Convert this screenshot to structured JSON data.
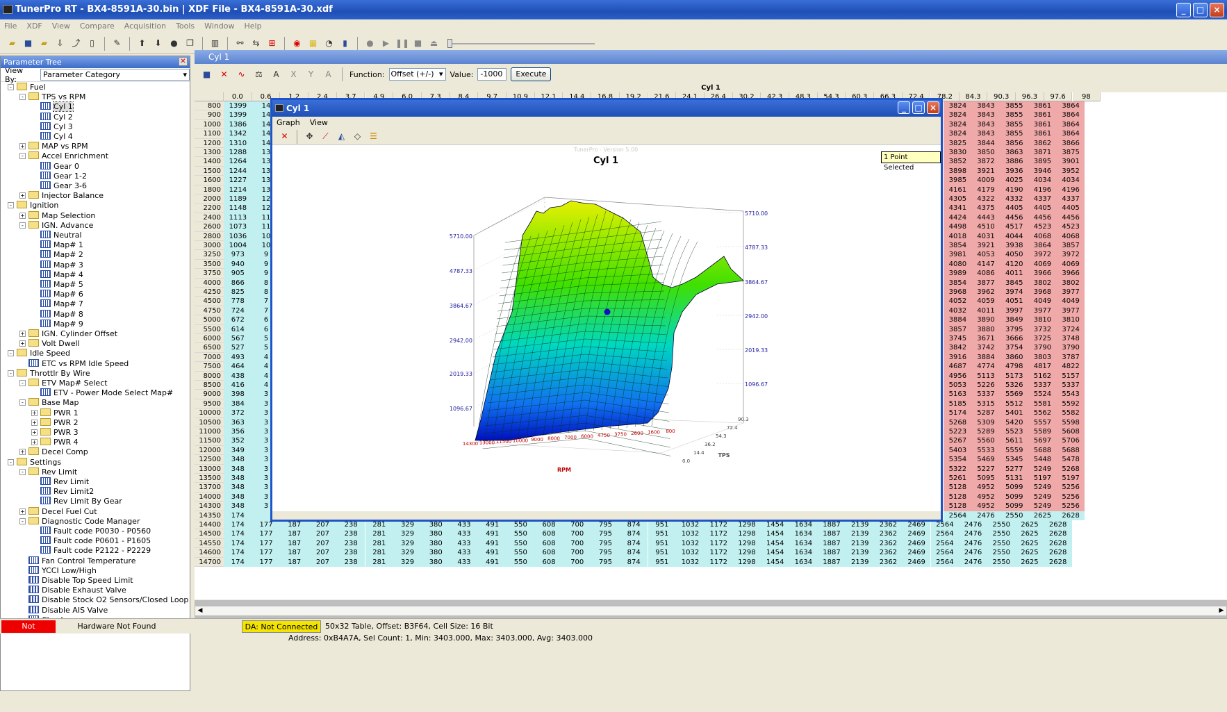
{
  "app": {
    "title": "TunerPro RT - BX4-8591A-30.bin | XDF File - BX4-8591A-30.xdf",
    "menu": [
      "File",
      "XDF",
      "View",
      "Compare",
      "Acquisition",
      "Tools",
      "Window",
      "Help"
    ]
  },
  "tree": {
    "title": "Parameter Tree",
    "view_by_label": "View By:",
    "view_by_value": "Parameter Category",
    "nodes": [
      [
        "Fuel",
        0,
        "fold",
        "-"
      ],
      [
        "TPS vs RPM",
        1,
        "fold",
        "-"
      ],
      [
        "Cyl 1",
        2,
        "grid",
        ""
      ],
      [
        "Cyl 2",
        2,
        "grid",
        ""
      ],
      [
        "Cyl 3",
        2,
        "grid",
        ""
      ],
      [
        "Cyl 4",
        2,
        "grid",
        ""
      ],
      [
        "MAP vs RPM",
        1,
        "fold",
        "+"
      ],
      [
        "Accel Enrichment",
        1,
        "fold",
        "-"
      ],
      [
        "Gear 0",
        2,
        "grid",
        ""
      ],
      [
        "Gear 1-2",
        2,
        "grid",
        ""
      ],
      [
        "Gear 3-6",
        2,
        "grid",
        ""
      ],
      [
        "Injector Balance",
        1,
        "fold",
        "+"
      ],
      [
        "Ignition",
        0,
        "fold",
        "-"
      ],
      [
        "Map Selection",
        1,
        "fold",
        "+"
      ],
      [
        "IGN. Advance",
        1,
        "fold",
        "-"
      ],
      [
        "Neutral",
        2,
        "grid",
        ""
      ],
      [
        "Map# 1",
        2,
        "grid",
        ""
      ],
      [
        "Map# 2",
        2,
        "grid",
        ""
      ],
      [
        "Map# 3",
        2,
        "grid",
        ""
      ],
      [
        "Map# 4",
        2,
        "grid",
        ""
      ],
      [
        "Map# 5",
        2,
        "grid",
        ""
      ],
      [
        "Map# 6",
        2,
        "grid",
        ""
      ],
      [
        "Map# 7",
        2,
        "grid",
        ""
      ],
      [
        "Map# 8",
        2,
        "grid",
        ""
      ],
      [
        "Map# 9",
        2,
        "grid",
        ""
      ],
      [
        "IGN. Cylinder Offset",
        1,
        "fold",
        "+"
      ],
      [
        "Volt Dwell",
        1,
        "fold",
        "+"
      ],
      [
        "Idle Speed",
        0,
        "fold",
        "-"
      ],
      [
        "ETC vs RPM Idle Speed",
        1,
        "grid",
        ""
      ],
      [
        "Throttlr By Wire",
        0,
        "fold",
        "-"
      ],
      [
        "ETV Map# Select",
        1,
        "fold",
        "-"
      ],
      [
        "ETV - Power Mode Select Map#",
        2,
        "grid",
        ""
      ],
      [
        "Base Map",
        1,
        "fold",
        "-"
      ],
      [
        "PWR 1",
        2,
        "fold",
        "+"
      ],
      [
        "PWR 2",
        2,
        "fold",
        "+"
      ],
      [
        "PWR 3",
        2,
        "fold",
        "+"
      ],
      [
        "PWR 4",
        2,
        "fold",
        "+"
      ],
      [
        "Decel Comp",
        1,
        "fold",
        "+"
      ],
      [
        "Settings",
        0,
        "fold",
        "-"
      ],
      [
        "Rev Limit",
        1,
        "fold",
        "-"
      ],
      [
        "Rev Limit",
        2,
        "grid",
        ""
      ],
      [
        "Rev Limit2",
        2,
        "grid",
        ""
      ],
      [
        "Rev Limit By Gear",
        2,
        "grid",
        ""
      ],
      [
        "Decel Fuel Cut",
        1,
        "fold",
        "+"
      ],
      [
        "Diagnostic Code Manager",
        1,
        "fold",
        "-"
      ],
      [
        "Fault code  P0030 - P0560",
        2,
        "grid",
        ""
      ],
      [
        "Fault code  P0601 - P1605",
        2,
        "grid",
        ""
      ],
      [
        "Fault code  P2122 - P2229",
        2,
        "grid",
        ""
      ],
      [
        "Fan Control Temperature",
        1,
        "grid",
        ""
      ],
      [
        "YCCI Low/High",
        1,
        "grid",
        ""
      ],
      [
        "Disable Top Speed Limit",
        1,
        "bits",
        ""
      ],
      [
        "Disable Exhaust Valve",
        1,
        "bits",
        ""
      ],
      [
        "Disable Stock O2 Sensors/Closed Loop",
        1,
        "bits",
        ""
      ],
      [
        "Disable AIS Valve",
        1,
        "bits",
        ""
      ],
      [
        "Checksum",
        1,
        "grid",
        ""
      ]
    ]
  },
  "panel": {
    "title": "Cyl 1",
    "function_label": "Function:",
    "function_value": "Offset (+/-)",
    "value_label": "Value:",
    "value": "-1000",
    "execute": "Execute",
    "table_title": "Cyl 1"
  },
  "table": {
    "cols_left": [
      "0.0",
      "0.6",
      "1.2",
      "2.4",
      "3.7",
      "4.9",
      "6.0",
      "7.3",
      "8.4",
      "9.7",
      "10.9",
      "12.1",
      "14.4",
      "16.8",
      "19.2",
      "21.6",
      "24.1",
      "26.4",
      "30.2",
      "42.3",
      "48.3",
      "54.3",
      "60.3",
      "66.3",
      "72.4"
    ],
    "cols_right": [
      "78.2",
      "84.3",
      "90.3",
      "96.3",
      "97.6",
      "98"
    ],
    "rpm": [
      "800",
      "900",
      "1000",
      "1100",
      "1200",
      "1300",
      "1400",
      "1500",
      "1600",
      "1800",
      "2000",
      "2200",
      "2400",
      "2600",
      "2800",
      "3000",
      "3250",
      "3500",
      "3750",
      "4000",
      "4250",
      "4500",
      "4750",
      "5000",
      "5500",
      "6000",
      "6500",
      "7000",
      "7500",
      "8000",
      "8500",
      "9000",
      "9500",
      "10000",
      "10500",
      "11000",
      "11500",
      "12000",
      "12500",
      "13000",
      "13500",
      "13700",
      "14000",
      "14300",
      "14350",
      "14400",
      "14500",
      "14550",
      "14600",
      "14700"
    ],
    "col0": [
      "1399",
      "1399",
      "1386",
      "1342",
      "1310",
      "1288",
      "1264",
      "1244",
      "1227",
      "1214",
      "1189",
      "1148",
      "1113",
      "1073",
      "1036",
      "1004",
      "973",
      "940",
      "905",
      "866",
      "825",
      "778",
      "724",
      "672",
      "614",
      "567",
      "527",
      "493",
      "464",
      "438",
      "416",
      "398",
      "384",
      "372",
      "363",
      "356",
      "352",
      "349",
      "348",
      "348",
      "348",
      "348",
      "348",
      "348",
      "174",
      "174",
      "174",
      "174",
      "174",
      "174"
    ],
    "col1": [
      "14",
      "14",
      "14",
      "14",
      "14",
      "13",
      "13",
      "13",
      "13",
      "13",
      "12",
      "12",
      "11",
      "11",
      "10",
      "10",
      "9",
      "9",
      "9",
      "8",
      "8",
      "7",
      "7",
      "6",
      "6",
      "5",
      "5",
      "4",
      "4",
      "4",
      "4",
      "3",
      "3",
      "3",
      "3",
      "3",
      "3",
      "3",
      "3",
      "3",
      "3",
      "3",
      "3",
      "3",
      "",
      "177",
      "177",
      "177",
      "177",
      "177"
    ],
    "bottom_row": [
      "174",
      "177",
      "187",
      "207",
      "238",
      "281",
      "329",
      "380",
      "433",
      "491",
      "550",
      "608",
      "700",
      "795",
      "874",
      "951",
      "1032",
      "1172",
      "1298",
      "1454",
      "1634",
      "1887",
      "2139",
      "2362",
      "2469",
      "2564",
      "2476",
      "2550",
      "2625",
      "2628"
    ],
    "right": [
      [
        "3824",
        "3843",
        "3855",
        "3861",
        "3864"
      ],
      [
        "3824",
        "3843",
        "3855",
        "3861",
        "3864"
      ],
      [
        "3824",
        "3843",
        "3855",
        "3861",
        "3864"
      ],
      [
        "3824",
        "3843",
        "3855",
        "3861",
        "3864"
      ],
      [
        "3825",
        "3844",
        "3856",
        "3862",
        "3866"
      ],
      [
        "3830",
        "3850",
        "3863",
        "3871",
        "3875"
      ],
      [
        "3852",
        "3872",
        "3886",
        "3895",
        "3901"
      ],
      [
        "3898",
        "3921",
        "3936",
        "3946",
        "3952"
      ],
      [
        "3985",
        "4009",
        "4025",
        "4034",
        "4034"
      ],
      [
        "4161",
        "4179",
        "4190",
        "4196",
        "4196"
      ],
      [
        "4305",
        "4322",
        "4332",
        "4337",
        "4337"
      ],
      [
        "4341",
        "4375",
        "4405",
        "4405",
        "4405"
      ],
      [
        "4424",
        "4443",
        "4456",
        "4456",
        "4456"
      ],
      [
        "4498",
        "4510",
        "4517",
        "4523",
        "4523"
      ],
      [
        "4018",
        "4031",
        "4044",
        "4068",
        "4068"
      ],
      [
        "3854",
        "3921",
        "3938",
        "3864",
        "3857"
      ],
      [
        "3981",
        "4053",
        "4050",
        "3972",
        "3972"
      ],
      [
        "4080",
        "4147",
        "4120",
        "4069",
        "4069"
      ],
      [
        "3989",
        "4086",
        "4011",
        "3966",
        "3966"
      ],
      [
        "3854",
        "3877",
        "3845",
        "3802",
        "3802"
      ],
      [
        "3968",
        "3962",
        "3974",
        "3968",
        "3977"
      ],
      [
        "4052",
        "4059",
        "4051",
        "4049",
        "4049"
      ],
      [
        "4032",
        "4011",
        "3997",
        "3977",
        "3977"
      ],
      [
        "3884",
        "3890",
        "3849",
        "3810",
        "3810"
      ],
      [
        "3857",
        "3880",
        "3795",
        "3732",
        "3724"
      ],
      [
        "3745",
        "3671",
        "3666",
        "3725",
        "3748"
      ],
      [
        "3842",
        "3742",
        "3754",
        "3790",
        "3790"
      ],
      [
        "3916",
        "3884",
        "3860",
        "3803",
        "3787"
      ],
      [
        "4687",
        "4774",
        "4798",
        "4817",
        "4822"
      ],
      [
        "4956",
        "5113",
        "5173",
        "5162",
        "5157"
      ],
      [
        "5053",
        "5226",
        "5326",
        "5337",
        "5337"
      ],
      [
        "5163",
        "5337",
        "5569",
        "5524",
        "5543"
      ],
      [
        "5185",
        "5315",
        "5512",
        "5581",
        "5592"
      ],
      [
        "5174",
        "5287",
        "5401",
        "5562",
        "5582"
      ],
      [
        "5268",
        "5309",
        "5420",
        "5557",
        "5598"
      ],
      [
        "5223",
        "5289",
        "5523",
        "5589",
        "5608"
      ],
      [
        "5267",
        "5560",
        "5611",
        "5697",
        "5706"
      ],
      [
        "5403",
        "5533",
        "5559",
        "5688",
        "5688"
      ],
      [
        "5354",
        "5469",
        "5345",
        "5448",
        "5478"
      ],
      [
        "5322",
        "5227",
        "5277",
        "5249",
        "5268"
      ],
      [
        "5261",
        "5095",
        "5131",
        "5197",
        "5197"
      ],
      [
        "5128",
        "4952",
        "5099",
        "5249",
        "5256"
      ],
      [
        "5128",
        "4952",
        "5099",
        "5249",
        "5256"
      ],
      [
        "5128",
        "4952",
        "5099",
        "5249",
        "5256"
      ],
      [
        "2564",
        "2476",
        "2550",
        "2625",
        "2628"
      ],
      [
        "2564",
        "2476",
        "2550",
        "2625",
        "2628"
      ],
      [
        "2564",
        "2476",
        "2550",
        "2625",
        "2628"
      ],
      [
        "2564",
        "2476",
        "2550",
        "2625",
        "2628"
      ],
      [
        "2564",
        "2476",
        "2550",
        "2625",
        "2628"
      ],
      [
        "2564",
        "2476",
        "2550",
        "2625",
        "2628"
      ]
    ]
  },
  "status": {
    "address": "Address: 0xB4A7A, Sel Count: 1, Min: 3403.000, Max: 3403.000, Avg: 3403.000"
  },
  "graph": {
    "title": "Cyl 1",
    "menu": [
      "Graph",
      "View"
    ],
    "watermark": "TunerPro - Version 5.00",
    "chart_title": "Cyl 1",
    "badge": "1 Point Selected",
    "z_ticks": [
      "5710.00",
      "4787.33",
      "3864.67",
      "2942.00",
      "2019.33",
      "1096.67"
    ],
    "rpm_ticks": [
      "14300",
      "13000",
      "11500",
      "10000",
      "9000",
      "8000",
      "7000",
      "6000",
      "4750",
      "3750",
      "2600",
      "1600",
      "800"
    ],
    "tps_ticks": [
      "90.3",
      "72.4",
      "54.3",
      "36.2",
      "14.4",
      "0.0"
    ],
    "x_label": "RPM",
    "y_label": "TPS"
  },
  "bottom": {
    "emulating": "Not Emulating",
    "hardware": "Hardware Not Found",
    "da": "DA: Not Connected",
    "table_info": "50x32 Table, Offset: B3F64,  Cell Size: 16 Bit"
  }
}
